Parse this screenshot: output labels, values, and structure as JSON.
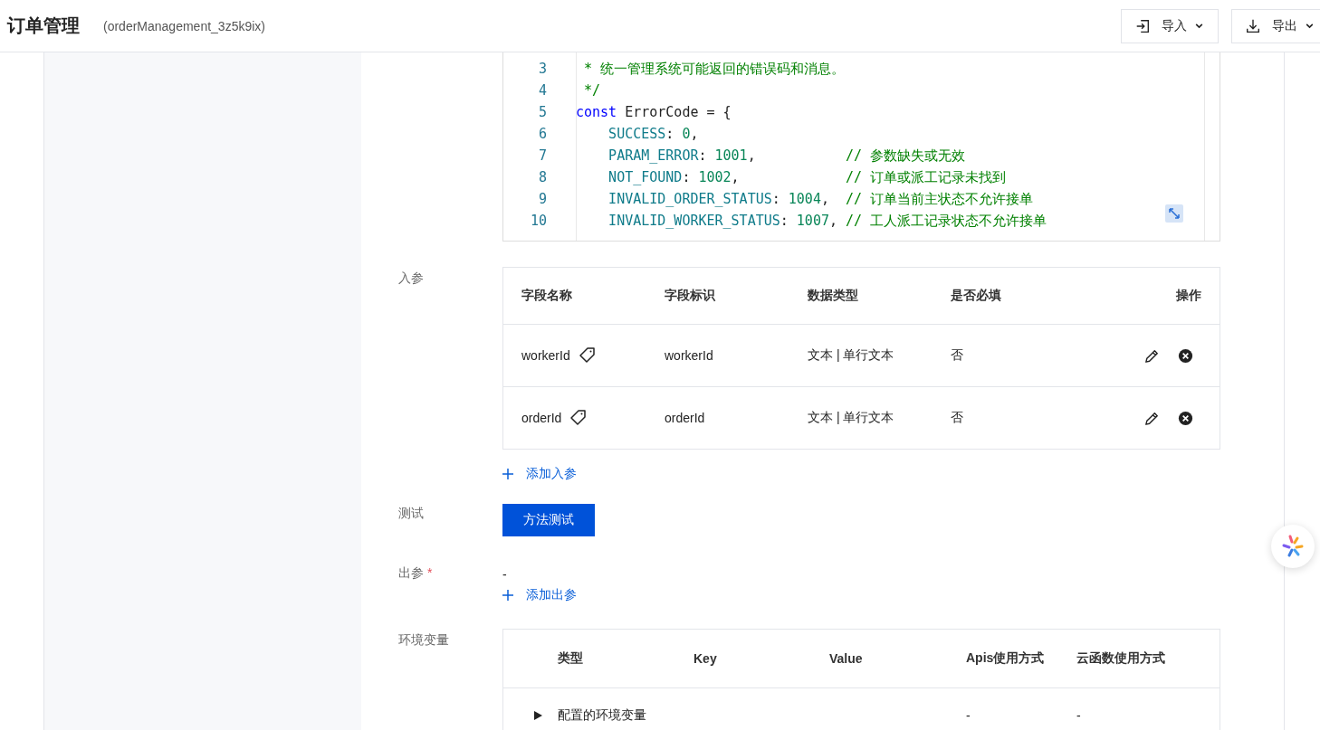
{
  "header": {
    "title": "订单管理",
    "subtitle": "(orderManagement_3z5k9ix)",
    "buttons": [
      {
        "label": "导入",
        "kind": "import"
      },
      {
        "label": "导出",
        "kind": "export"
      }
    ]
  },
  "code": {
    "lines": [
      {
        "number": "3",
        "segments": [
          {
            "text": " * 统一管理系统可能返回的错误码和消息。",
            "kind": "comment"
          }
        ]
      },
      {
        "number": "4",
        "segments": [
          {
            "text": " */",
            "kind": "comment"
          }
        ]
      },
      {
        "number": "5",
        "segments": [
          {
            "text": "const",
            "kind": "keyword"
          },
          {
            "text": " ErrorCode = {",
            "kind": "plain"
          }
        ]
      },
      {
        "number": "6",
        "segments": [
          {
            "text": "    SUCCESS",
            "kind": "property"
          },
          {
            "text": ": ",
            "kind": "plain"
          },
          {
            "text": "0",
            "kind": "number"
          },
          {
            "text": ",",
            "kind": "plain"
          }
        ]
      },
      {
        "number": "7",
        "segments": [
          {
            "text": "    PARAM_ERROR",
            "kind": "property"
          },
          {
            "text": ": ",
            "kind": "plain"
          },
          {
            "text": "1001",
            "kind": "number"
          },
          {
            "text": ",           ",
            "kind": "plain"
          },
          {
            "text": "// 参数缺失或无效",
            "kind": "comment"
          }
        ]
      },
      {
        "number": "8",
        "segments": [
          {
            "text": "    NOT_FOUND",
            "kind": "property"
          },
          {
            "text": ": ",
            "kind": "plain"
          },
          {
            "text": "1002",
            "kind": "number"
          },
          {
            "text": ",             ",
            "kind": "plain"
          },
          {
            "text": "// 订单或派工记录未找到",
            "kind": "comment"
          }
        ]
      },
      {
        "number": "9",
        "segments": [
          {
            "text": "    INVALID_ORDER_STATUS",
            "kind": "property"
          },
          {
            "text": ": ",
            "kind": "plain"
          },
          {
            "text": "1004",
            "kind": "number"
          },
          {
            "text": ",  ",
            "kind": "plain"
          },
          {
            "text": "// 订单当前主状态不允许接单",
            "kind": "comment"
          }
        ]
      },
      {
        "number": "10",
        "segments": [
          {
            "text": "    INVALID_WORKER_STATUS",
            "kind": "property"
          },
          {
            "text": ": ",
            "kind": "plain"
          },
          {
            "text": "1007",
            "kind": "number"
          },
          {
            "text": ", ",
            "kind": "plain"
          },
          {
            "text": "// 工人派工记录状态不允许接单",
            "kind": "comment"
          }
        ]
      }
    ]
  },
  "input_params": {
    "label": "入参",
    "columns": [
      "字段名称",
      "字段标识",
      "数据类型",
      "是否必填",
      "操作"
    ],
    "rows": [
      {
        "name": "workerId",
        "identifier": "workerId",
        "type": "文本 | 单行文本",
        "required": "否"
      },
      {
        "name": "orderId",
        "identifier": "orderId",
        "type": "文本 | 单行文本",
        "required": "否"
      }
    ],
    "add_link": "添加入参"
  },
  "test": {
    "label": "测试",
    "button": "方法测试"
  },
  "output_params": {
    "label": "出参",
    "required_mark": "*",
    "value": "-",
    "add_link": "添加出参"
  },
  "env_vars": {
    "label": "环境变量",
    "columns": [
      "类型",
      "Key",
      "Value",
      "Apis使用方式",
      "云函数使用方式"
    ],
    "rows": [
      {
        "type": "配置的环境变量",
        "expanded": false,
        "apis": "-",
        "cloud": "-"
      }
    ]
  }
}
